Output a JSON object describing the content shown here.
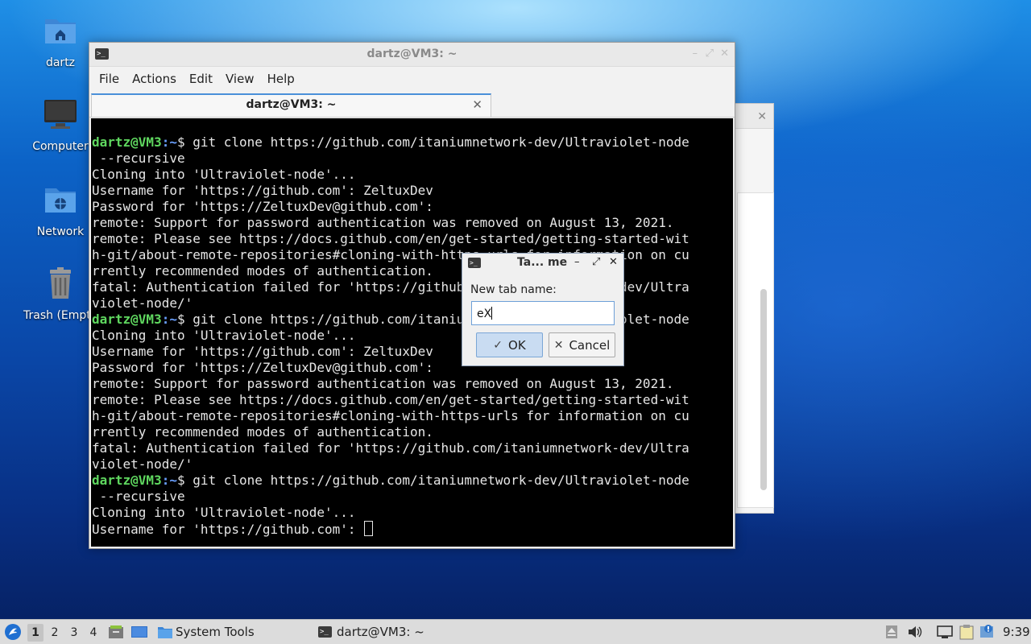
{
  "desktop": {
    "icons": [
      {
        "label": "dartz",
        "icon": "home-folder-icon"
      },
      {
        "label": "Computer",
        "icon": "computer-icon"
      },
      {
        "label": "Network",
        "icon": "network-folder-icon"
      },
      {
        "label": "Trash (Empty)",
        "icon": "trash-icon"
      }
    ]
  },
  "terminal": {
    "title": "dartz@VM3: ~",
    "menu": [
      "File",
      "Actions",
      "Edit",
      "View",
      "Help"
    ],
    "tab_label": "dartz@VM3: ~",
    "tab_close": "✕",
    "prompt_user": "dartz@VM3",
    "prompt_path": ":~",
    "prompt_sign": "$ ",
    "lines": [
      {
        "type": "cmd",
        "text": "git clone https://github.com/itaniumnetwork-dev/Ultraviolet-node"
      },
      {
        "type": "out",
        "text": " --recursive"
      },
      {
        "type": "out",
        "text": "Cloning into 'Ultraviolet-node'..."
      },
      {
        "type": "out",
        "text": "Username for 'https://github.com': ZeltuxDev"
      },
      {
        "type": "out",
        "text": "Password for 'https://ZeltuxDev@github.com':"
      },
      {
        "type": "out",
        "text": "remote: Support for password authentication was removed on August 13, 2021."
      },
      {
        "type": "out",
        "text": "remote: Please see https://docs.github.com/en/get-started/getting-started-wit"
      },
      {
        "type": "out",
        "text": "h-git/about-remote-repositories#cloning-with-https-urls for information on cu"
      },
      {
        "type": "out",
        "text": "rrently recommended modes of authentication."
      },
      {
        "type": "out",
        "text": "fatal: Authentication failed for 'https://github.com/itaniumnetwork-dev/Ultra"
      },
      {
        "type": "out",
        "text": "violet-node/'"
      },
      {
        "type": "cmd",
        "text": "git clone https://github.com/itaniumnetwork-dev/Ultraviolet-node"
      },
      {
        "type": "out",
        "text": "Cloning into 'Ultraviolet-node'..."
      },
      {
        "type": "out",
        "text": "Username for 'https://github.com': ZeltuxDev"
      },
      {
        "type": "out",
        "text": "Password for 'https://ZeltuxDev@github.com':"
      },
      {
        "type": "out",
        "text": "remote: Support for password authentication was removed on August 13, 2021."
      },
      {
        "type": "out",
        "text": "remote: Please see https://docs.github.com/en/get-started/getting-started-wit"
      },
      {
        "type": "out",
        "text": "h-git/about-remote-repositories#cloning-with-https-urls for information on cu"
      },
      {
        "type": "out",
        "text": "rrently recommended modes of authentication."
      },
      {
        "type": "out",
        "text": "fatal: Authentication failed for 'https://github.com/itaniumnetwork-dev/Ultra"
      },
      {
        "type": "out",
        "text": "violet-node/'"
      },
      {
        "type": "cmd",
        "text": "git clone https://github.com/itaniumnetwork-dev/Ultraviolet-node"
      },
      {
        "type": "out",
        "text": " --recursive"
      },
      {
        "type": "out",
        "text": "Cloning into 'Ultraviolet-node'..."
      },
      {
        "type": "out",
        "text": "Username for 'https://github.com': ",
        "cursor": true
      }
    ]
  },
  "dialog": {
    "title": "Ta... me",
    "label": "New tab name:",
    "input_value": "eX",
    "ok_label": "OK",
    "cancel_label": "Cancel"
  },
  "taskbar": {
    "workspaces": [
      "1",
      "2",
      "3",
      "4"
    ],
    "active_workspace": "1",
    "system_tools_label": "System Tools",
    "task_label": "dartz@VM3: ~",
    "clock": "9:39"
  },
  "colors": {
    "prompt_user": "#5fd75f",
    "prompt_path": "#6aa0ff",
    "accent": "#4a90d9"
  }
}
